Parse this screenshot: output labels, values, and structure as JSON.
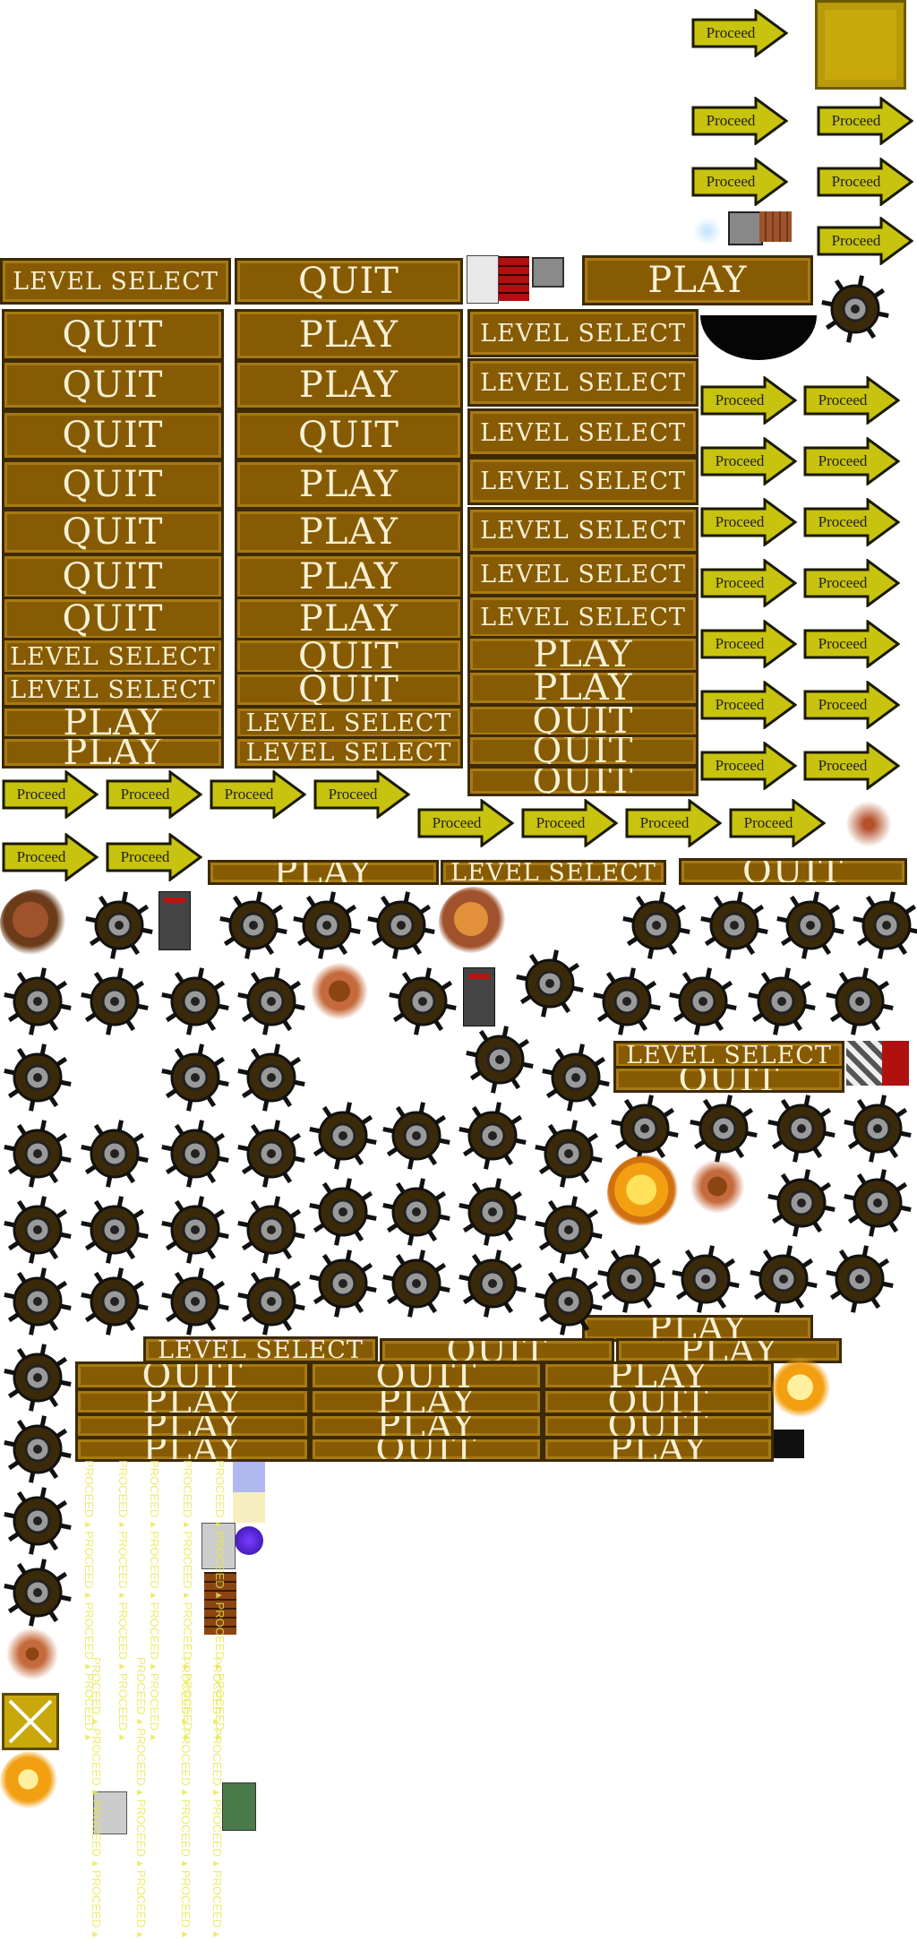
{
  "labels": {
    "proceed": "Proceed",
    "play": "PLAY",
    "quit": "QUIT",
    "level_select": "LEVEL SELECT"
  },
  "proceed_stripe": "PROCEED",
  "colors": {
    "wood": "#865b04",
    "wood_dark": "#3d2a05",
    "arrow_yellow": "#c8c30f",
    "arrow_edge": "#1a1a00",
    "wheel_rim": "#3b2a0a",
    "wheel_hub": "#9a9a9a",
    "explosion_orange": "#f2a012",
    "dust_brown": "#8b4513",
    "brick_red": "#b01010"
  },
  "icons": {
    "wheel": "spiked-wheel-icon",
    "explosion": "explosion-icon",
    "dust": "dust-cloud-icon",
    "robot": "robot-icon",
    "crate": "crate-icon"
  }
}
